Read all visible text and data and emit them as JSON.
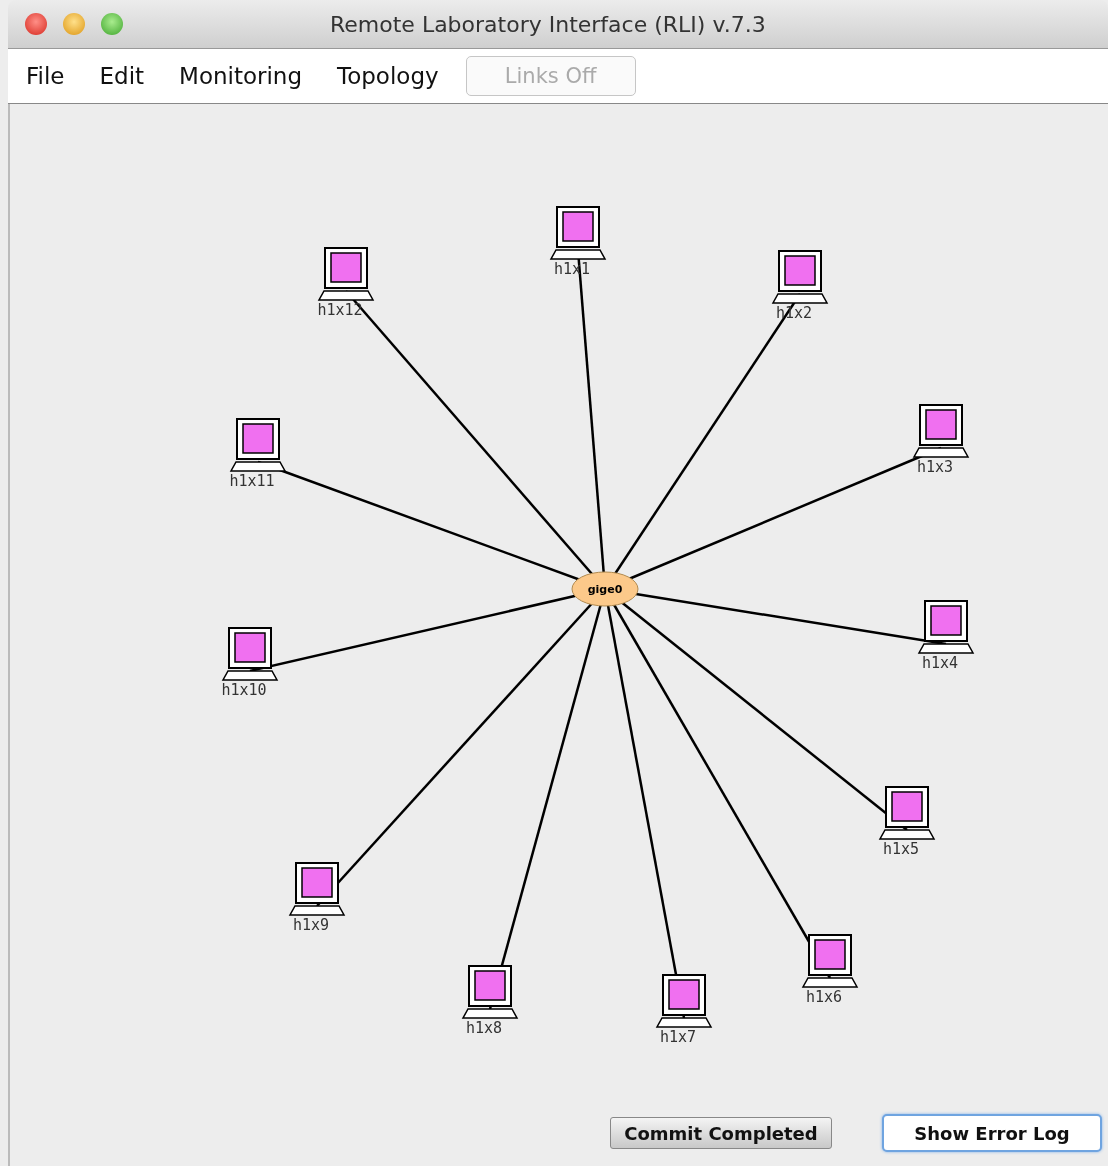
{
  "window": {
    "title": "Remote Laboratory Interface (RLI) v.7.3"
  },
  "menu": [
    {
      "label": "File"
    },
    {
      "label": "Edit"
    },
    {
      "label": "Monitoring"
    },
    {
      "label": "Topology"
    }
  ],
  "toolbar_button": {
    "label": "Links Off",
    "disabled": true
  },
  "topology": {
    "hub": {
      "label": "gige0"
    },
    "hosts": [
      {
        "label": "h1x1"
      },
      {
        "label": "h1x2"
      },
      {
        "label": "h1x3"
      },
      {
        "label": "h1x4"
      },
      {
        "label": "h1x5"
      },
      {
        "label": "h1x6"
      },
      {
        "label": "h1x7"
      },
      {
        "label": "h1x8"
      },
      {
        "label": "h1x9"
      },
      {
        "label": "h1x10"
      },
      {
        "label": "h1x11"
      },
      {
        "label": "h1x12"
      }
    ]
  },
  "buttons": [
    {
      "label": "Commit Completed",
      "focused": false
    },
    {
      "label": "Show Error Log",
      "focused": true
    }
  ]
}
